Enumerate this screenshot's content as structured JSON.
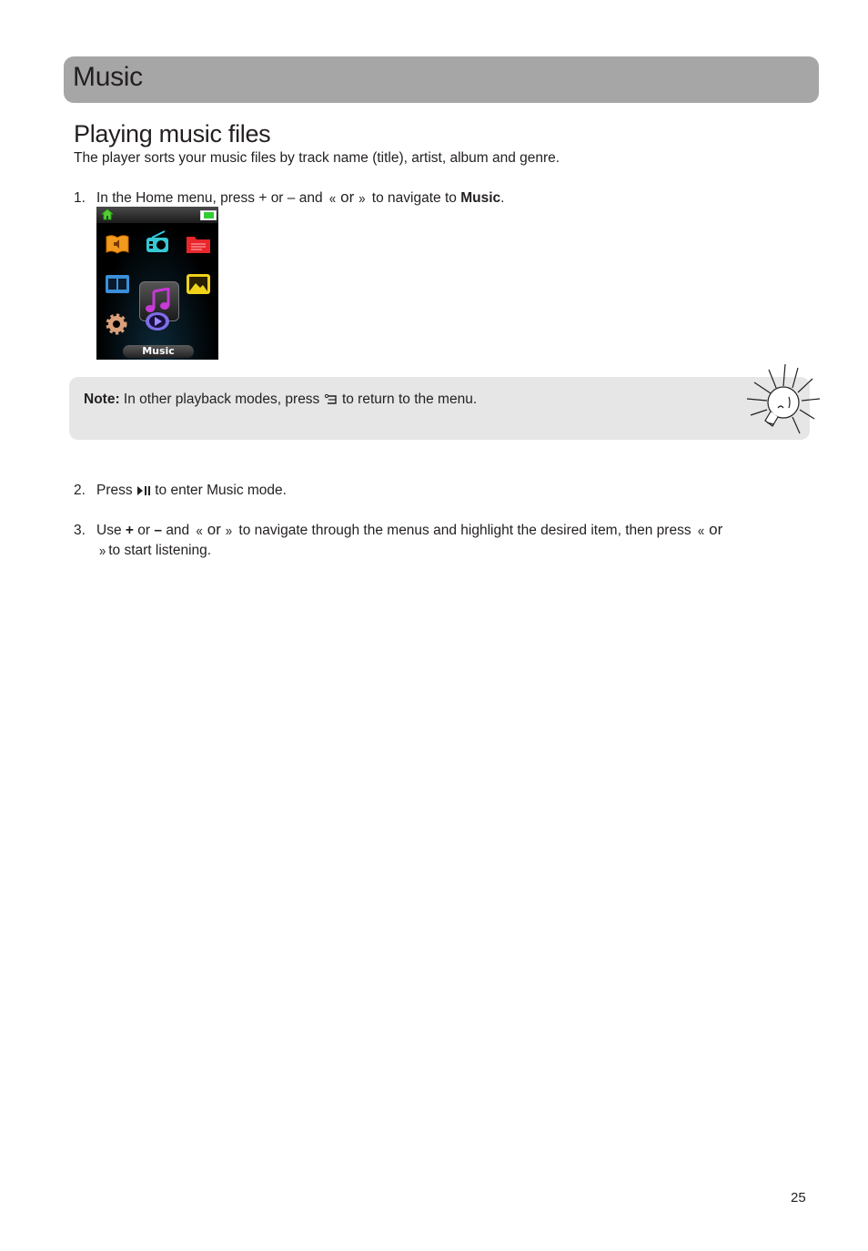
{
  "header": {
    "title": "Music",
    "color": "#a7a6a6"
  },
  "section": {
    "title": "Playing music files",
    "intro": "The player sorts your music files by track name (title), artist, album and genre."
  },
  "steps": [
    {
      "number": "1.",
      "text_before": "In the Home menu, press + or – and",
      "or": "or",
      "text_after": "to navigate to",
      "bold": "Music",
      "end": "."
    },
    {
      "number": "2.",
      "text_before": "Press",
      "text_after": "to enter Music mode."
    },
    {
      "number": "3.",
      "text_before_1": "Use",
      "plus": "+",
      "or1": "or",
      "minus": "–",
      "and": "and",
      "or2": "or",
      "text_middle": "to navigate through the menus and highlight the desired item, then press",
      "or3": "or",
      "text_end": "to start listening."
    }
  ],
  "device_screen": {
    "label": "Music",
    "icons": [
      "audiobook-icon",
      "radio-icon",
      "folder-icon",
      "video-icon",
      "music-icon",
      "photo-icon",
      "settings-icon",
      "playback-icon"
    ],
    "selected": "music-icon",
    "status": {
      "home": "home-icon",
      "battery": "battery-icon"
    }
  },
  "note": {
    "label": "Note:",
    "text_before": "In other playback modes, press",
    "text_after": "to return to the menu."
  },
  "page_number": "25"
}
